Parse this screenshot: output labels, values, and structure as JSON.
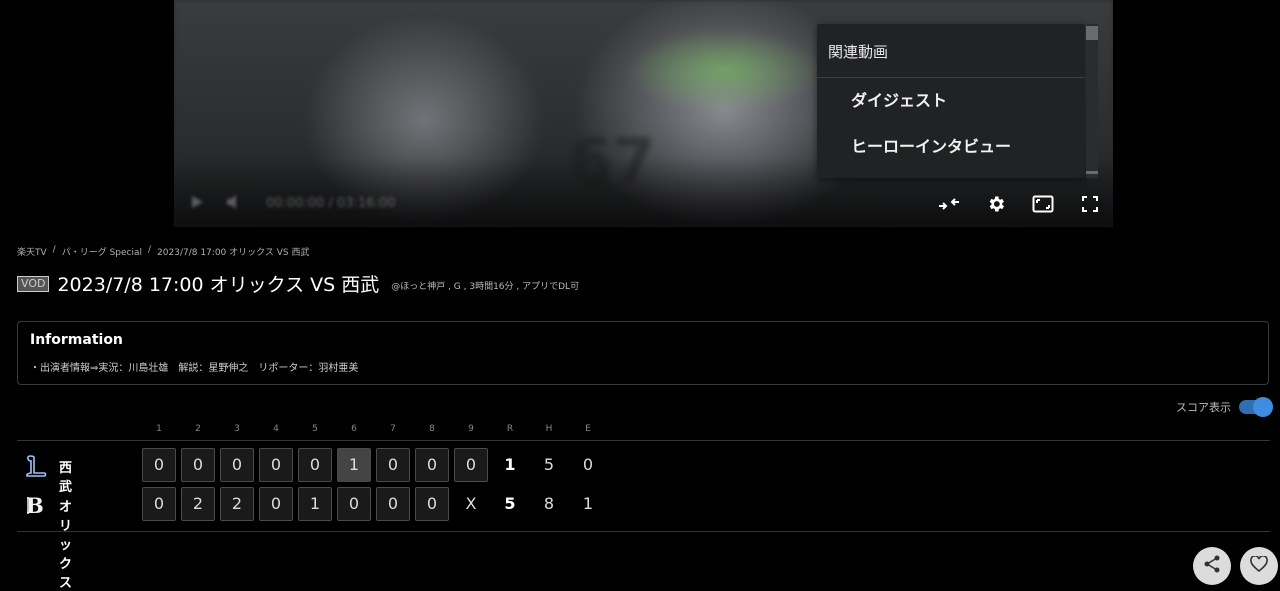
{
  "related": {
    "header": "関連動画",
    "items": [
      "ダイジェスト",
      "ヒーローインタビュー"
    ]
  },
  "player": {
    "time": "00:00:00 / 03:16:00"
  },
  "breadcrumb": [
    "楽天TV",
    "/",
    "パ・リーグ Special",
    "/",
    "2023/7/8 17:00 オリックス VS 西武"
  ],
  "title": {
    "badge": "VOD",
    "text": "2023/7/8 17:00 オリックス VS 西武",
    "meta": "@ほっと神戸 , G , 3時間16分 , アプリでDL可"
  },
  "info": {
    "heading": "Information",
    "content": "・出演者情報⇒実況：川島壮雄　解説：星野伸之　リポーター：羽村亜美"
  },
  "score_toggle": {
    "label": "スコア表示",
    "on": true
  },
  "scoreboard": {
    "columns": [
      "1",
      "2",
      "3",
      "4",
      "5",
      "6",
      "7",
      "8",
      "9",
      "R",
      "H",
      "E"
    ],
    "teams": [
      {
        "name": "西武",
        "innings": [
          "0",
          "0",
          "0",
          "0",
          "0",
          "1",
          "0",
          "0",
          "0"
        ],
        "R": "1",
        "H": "5",
        "E": "0"
      },
      {
        "name": "オリックス",
        "innings": [
          "0",
          "2",
          "2",
          "0",
          "1",
          "0",
          "0",
          "0",
          "X"
        ],
        "R": "5",
        "H": "8",
        "E": "1"
      }
    ]
  },
  "colors": {
    "toggle": "#3f8de0",
    "background": "#000000"
  },
  "icons": [
    "play-icon",
    "volume-icon",
    "collapse-icon",
    "gear-icon",
    "picture-in-picture-icon",
    "fullscreen-icon",
    "share-icon",
    "heart-icon"
  ]
}
